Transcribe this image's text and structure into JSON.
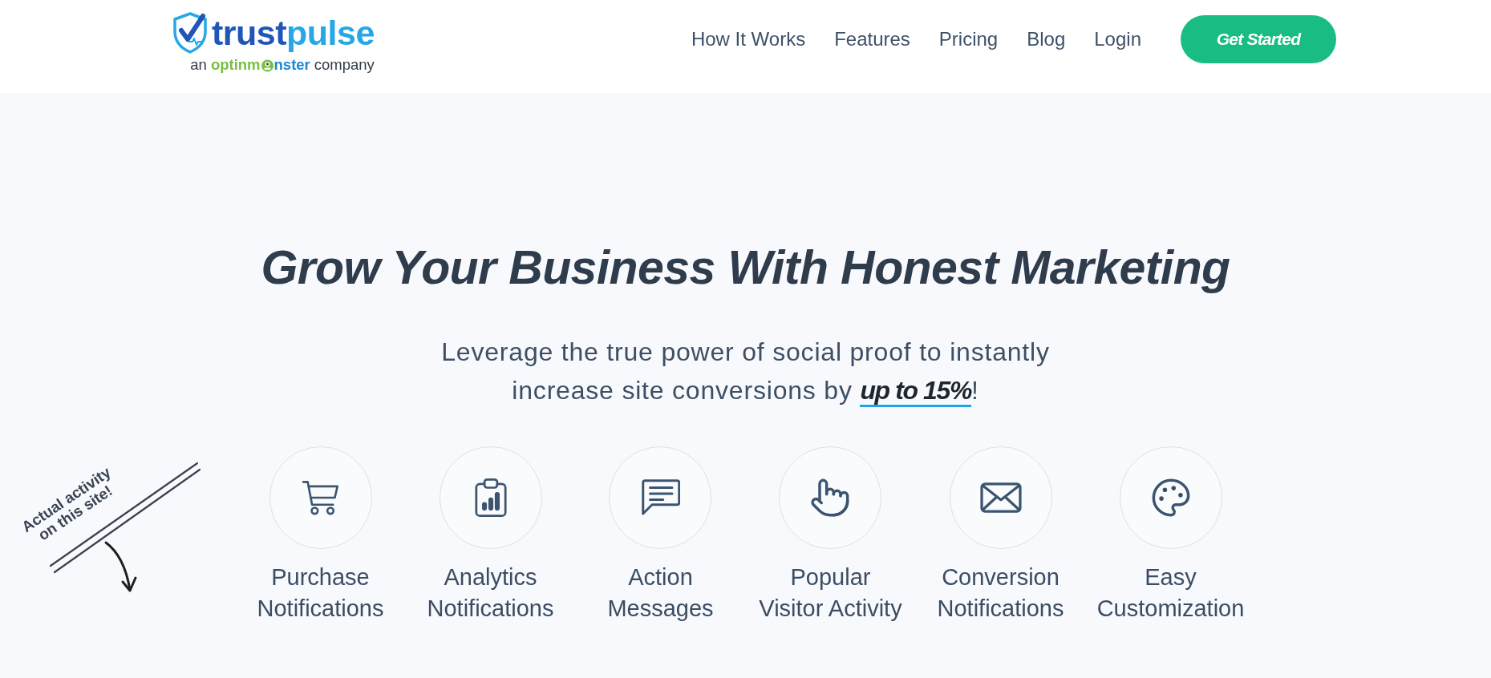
{
  "header": {
    "logo": {
      "wordmark_parts": [
        "trust",
        "pulse"
      ],
      "tagline": {
        "prefix": "an",
        "partner_parts": [
          "optinm",
          "nster"
        ],
        "suffix": "company"
      }
    },
    "nav": [
      {
        "label": "How It Works"
      },
      {
        "label": "Features"
      },
      {
        "label": "Pricing"
      },
      {
        "label": "Blog"
      },
      {
        "label": "Login"
      }
    ],
    "cta": {
      "label": "Get Started"
    }
  },
  "hero": {
    "heading": "Grow Your Business With Honest Marketing",
    "subtitle_lines": [
      "Leverage the true power of social proof to instantly",
      "increase site conversions by **up to 15%**!"
    ],
    "annotation_lines": [
      "Actual activity",
      "on this site!"
    ],
    "features": [
      {
        "lines": [
          "Purchase",
          "Notifications"
        ]
      },
      {
        "lines": [
          "Analytics",
          "Notifications"
        ]
      },
      {
        "lines": [
          "Action",
          "Messages"
        ]
      },
      {
        "lines": [
          "Popular",
          "Visitor Activity"
        ]
      },
      {
        "lines": [
          "Conversion",
          "Notifications"
        ]
      },
      {
        "lines": [
          "Easy",
          "Customization"
        ]
      }
    ]
  }
}
